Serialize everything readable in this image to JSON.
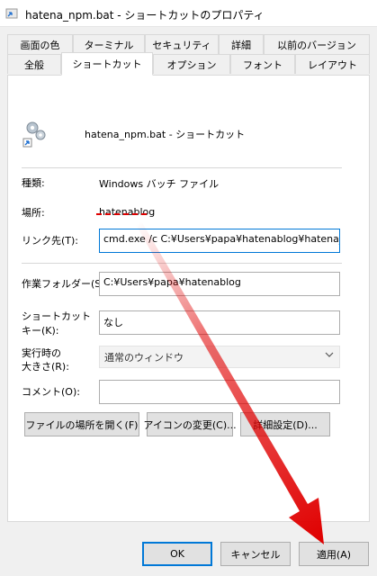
{
  "window": {
    "title": "hatena_npm.bat - ショートカットのプロパティ"
  },
  "tabs": {
    "back": [
      "画面の色",
      "ターミナル",
      "セキュリティ",
      "詳細",
      "以前のバージョン"
    ],
    "front": [
      "全般",
      "ショートカット",
      "オプション",
      "フォント",
      "レイアウト"
    ],
    "active": "ショートカット"
  },
  "header": {
    "file_name": "hatena_npm.bat - ショートカット"
  },
  "fields": {
    "type_label": "種類:",
    "type_value": "Windows バッチ ファイル",
    "location_label": "場所:",
    "location_value": "hatenablog",
    "target_label": "リンク先(T):",
    "target_value": "cmd.exe /c C:¥Users¥papa¥hatenablog¥hatena_npm",
    "workdir_label": "作業フォルダー(S):",
    "workdir_value": "C:¥Users¥papa¥hatenablog",
    "hotkey_label_1": "ショートカット",
    "hotkey_label_2": "キー(K):",
    "hotkey_value": "なし",
    "run_label_1": "実行時の",
    "run_label_2": "大きさ(R):",
    "run_value": "通常のウィンドウ",
    "comment_label": "コメント(O):",
    "comment_value": ""
  },
  "actions": {
    "open_location": "ファイルの場所を開く(F)",
    "change_icon": "アイコンの変更(C)...",
    "advanced": "詳細設定(D)..."
  },
  "footer": {
    "ok": "OK",
    "cancel": "キャンセル",
    "apply": "適用(A)"
  },
  "colors": {
    "annotation_red": "#e00000",
    "focus_blue": "#0078d7"
  }
}
